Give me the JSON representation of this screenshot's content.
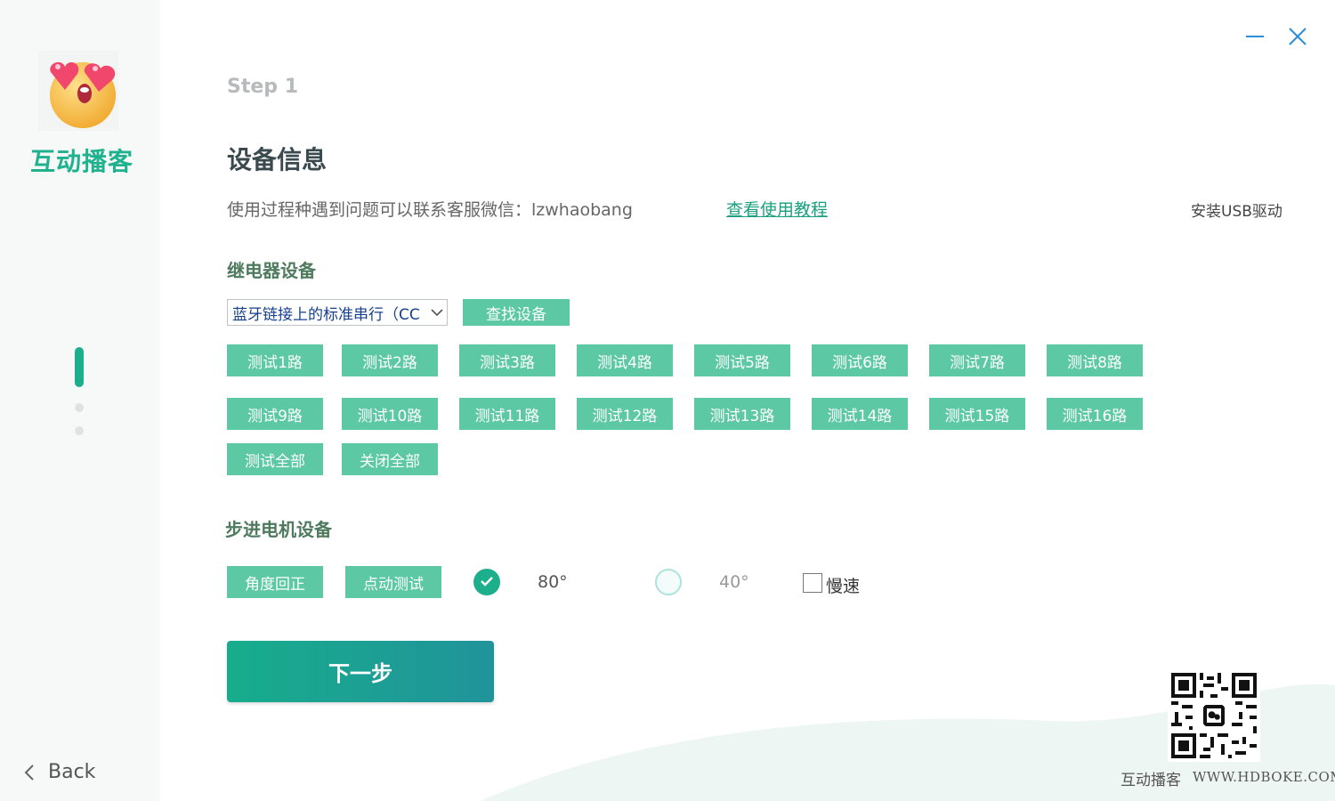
{
  "sidebar": {
    "app_name": "互动播客",
    "back_label": "Back",
    "logo_icon": "heart-eyes-emoji-icon"
  },
  "window": {
    "minimize_icon": "minimize-icon",
    "close_icon": "close-icon",
    "accent": "#2a8fd8"
  },
  "main": {
    "step_label": "Step 1",
    "title": "设备信息",
    "info_text": "使用过程种遇到问题可以联系客服微信：lzwhaobang",
    "tutorial_link": "查看使用教程",
    "usb_driver": "安装USB驱动",
    "relay": {
      "title": "继电器设备",
      "port_value": "蓝牙链接上的标准串行（CC",
      "find_button": "查找设备",
      "channels": [
        "测试1路",
        "测试2路",
        "测试3路",
        "测试4路",
        "测试5路",
        "测试6路",
        "测试7路",
        "测试8路",
        "测试9路",
        "测试10路",
        "测试11路",
        "测试12路",
        "测试13路",
        "测试14路",
        "测试15路",
        "测试16路"
      ],
      "test_all": "测试全部",
      "close_all": "关闭全部"
    },
    "motor": {
      "title": "步进电机设备",
      "reset_angle": "角度回正",
      "jog_test": "点动测试",
      "angle_80": "80°",
      "angle_40": "40°",
      "selected_angle": "80°",
      "slow_label": "慢速",
      "slow_checked": false
    },
    "next_button": "下一步"
  },
  "footer": {
    "brand": "互动播客",
    "site": "WWW.HDBOKE.COM",
    "qr_icon": "wechat-qr-code-icon"
  },
  "colors": {
    "accent": "#1dae8c",
    "button": "#5cc8a4",
    "brand": "#20b28e"
  }
}
